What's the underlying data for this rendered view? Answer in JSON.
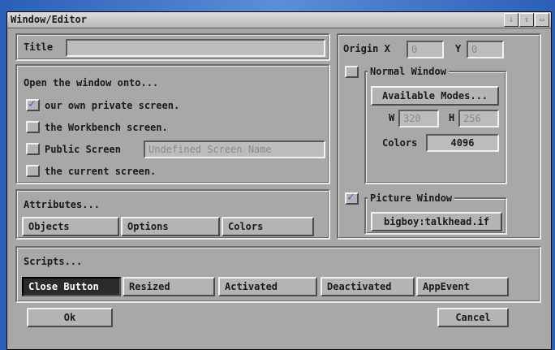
{
  "window": {
    "title": "Window/Editor",
    "gadgets": [
      "⇩",
      "⇧",
      "▭"
    ]
  },
  "title_field": {
    "label": "Title",
    "value": ""
  },
  "open_onto": {
    "heading": "Open the window onto...",
    "options": [
      {
        "label": "our own private screen.",
        "checked": true
      },
      {
        "label": "the Workbench screen.",
        "checked": false
      },
      {
        "label": "Public Screen",
        "checked": false
      },
      {
        "label": "the current screen.",
        "checked": false
      }
    ],
    "public_screen_placeholder": "Undefined Screen Name"
  },
  "attributes": {
    "heading": "Attributes...",
    "buttons": [
      "Objects",
      "Options",
      "Colors"
    ]
  },
  "origin": {
    "label": "Origin X",
    "x": "0",
    "y_label": "Y",
    "y": "0"
  },
  "normal_window": {
    "label": "Normal Window",
    "checked": false,
    "modes_button": "Available Modes...",
    "w_label": "W",
    "w": "320",
    "h_label": "H",
    "h": "256",
    "colors_label": "Colors",
    "colors": "4096"
  },
  "picture_window": {
    "label": "Picture Window",
    "checked": true,
    "file": "bigboy:talkhead.if"
  },
  "scripts": {
    "heading": "Scripts...",
    "buttons": [
      "Close Button",
      "Resized",
      "Activated",
      "Deactivated",
      "AppEvent"
    ],
    "selected": "Close Button"
  },
  "footer": {
    "ok": "Ok",
    "cancel": "Cancel"
  },
  "colors": {
    "desktop": "#3a6fc2",
    "window_bg": "#a8a8a8",
    "check_tick": "#3a5fd8",
    "selected_bg": "#2a2a2a"
  },
  "icons": {
    "check": "check-tick-icon"
  }
}
